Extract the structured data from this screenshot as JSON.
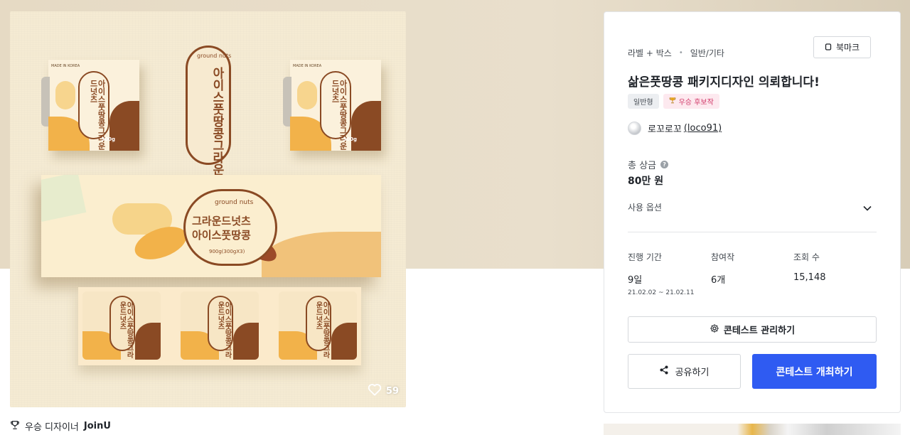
{
  "hero": {
    "likes_count": "59",
    "brand_sub": "ground nuts",
    "brand_line1": "그라운드넛츠",
    "brand_line2": "아이스풋땅콩",
    "small_box_weight": "300g",
    "made_in": "MADE IN KOREA",
    "lid_weight": "900g(300gX3)"
  },
  "designer": {
    "prefix": "우승 디자이너",
    "name": "JoinU"
  },
  "panel": {
    "category_main": "라벨 + 박스",
    "category_sub": "일반/기타",
    "bookmark_label": "북마크",
    "title": "삶은풋땅콩 패키지디자인 의뢰합니다!",
    "tag_type": "일반형",
    "tag_award": "우승 후보작",
    "owner_name": "로꼬로꼬",
    "owner_handle": "(loco91)",
    "prize_label": "총 상금",
    "prize_value": "80만 원",
    "usage_label": "사용 옵션",
    "stats": {
      "duration_label": "진행 기간",
      "duration_value": "9일",
      "duration_range": "21.02.02 ~ 21.02.11",
      "entries_label": "참여작",
      "entries_value": "6개",
      "views_label": "조회 수",
      "views_value": "15,148"
    },
    "manage_label": "콘테스트 관리하기",
    "share_label": "공유하기",
    "host_label": "콘테스트 개최하기"
  },
  "colors": {
    "primary": "#2f5bf2",
    "award_pink": "#d13a6a",
    "package_brown": "#8a4a24",
    "package_orange": "#f2b24a"
  },
  "icons": {
    "bookmark": "bookmark-icon",
    "trophy": "trophy-icon",
    "help": "help-icon",
    "chevron": "chevron-down-icon",
    "gear": "gear-icon",
    "share": "share-icon",
    "heart": "heart-icon"
  }
}
